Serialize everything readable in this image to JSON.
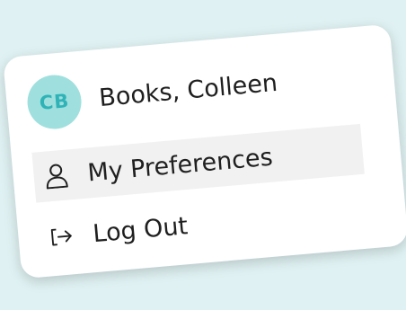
{
  "user": {
    "initials": "CB",
    "name": "Books, Colleen"
  },
  "menu": {
    "items": [
      {
        "label": "My Preferences",
        "icon": "person-icon",
        "active": true
      },
      {
        "label": "Log Out",
        "icon": "logout-icon",
        "active": false
      }
    ]
  },
  "colors": {
    "background": "#dff1f2",
    "avatar_bg": "#9fe0de",
    "avatar_text": "#2fb3b7",
    "highlight": "#f1f1f1",
    "text": "#1f1f1f"
  }
}
